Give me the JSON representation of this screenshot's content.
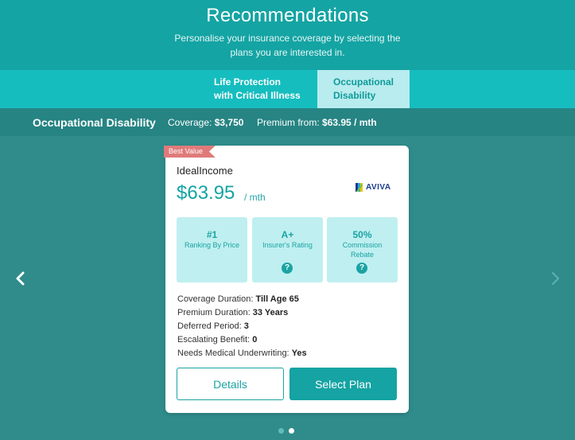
{
  "header": {
    "title": "Recommendations",
    "subtitle": "Personalise your insurance coverage by selecting the plans you are interested in."
  },
  "tabs": [
    {
      "label_line1": "Life Protection",
      "label_line2": "with Critical Illness",
      "active": false
    },
    {
      "label_line1": "Occupational",
      "label_line2": "Disability",
      "active": true
    }
  ],
  "summary": {
    "plan_name": "Occupational Disability",
    "coverage_label": "Coverage:",
    "coverage_value": "$3,750",
    "premium_label": "Premium from:",
    "premium_value": "$63.95 / mth"
  },
  "card": {
    "badge": "Best Value",
    "product_name": "IdealIncome",
    "price": "$63.95",
    "price_unit": "/ mth",
    "insurer_logo_text": "AVIVA",
    "stats": [
      {
        "value": "#1",
        "label": "Ranking By Price",
        "has_help": false
      },
      {
        "value": "A+",
        "label": "Insurer's Rating",
        "has_help": true
      },
      {
        "value": "50%",
        "label": "Commission Rebate",
        "has_help": true
      }
    ],
    "details": [
      {
        "label": "Coverage Duration:",
        "value": "Till Age 65"
      },
      {
        "label": "Premium Duration:",
        "value": "33 Years"
      },
      {
        "label": "Deferred Period:",
        "value": "3"
      },
      {
        "label": "Escalating Benefit:",
        "value": "0"
      },
      {
        "label": "Needs Medical Underwriting:",
        "value": "Yes"
      }
    ],
    "details_button": "Details",
    "select_button": "Select Plan"
  },
  "pagination": {
    "total": 2,
    "active_index": 1
  },
  "icons": {
    "help": "?"
  },
  "colors": {
    "header_bg": "#14a4a3",
    "tab_bar_bg": "#16bdbf",
    "active_tab_bg": "#b8ecee",
    "page_bg": "#2f8c8a",
    "accent": "#15a3a3",
    "badge_bg": "#e07a7a",
    "stat_bg": "#bfeff0"
  }
}
